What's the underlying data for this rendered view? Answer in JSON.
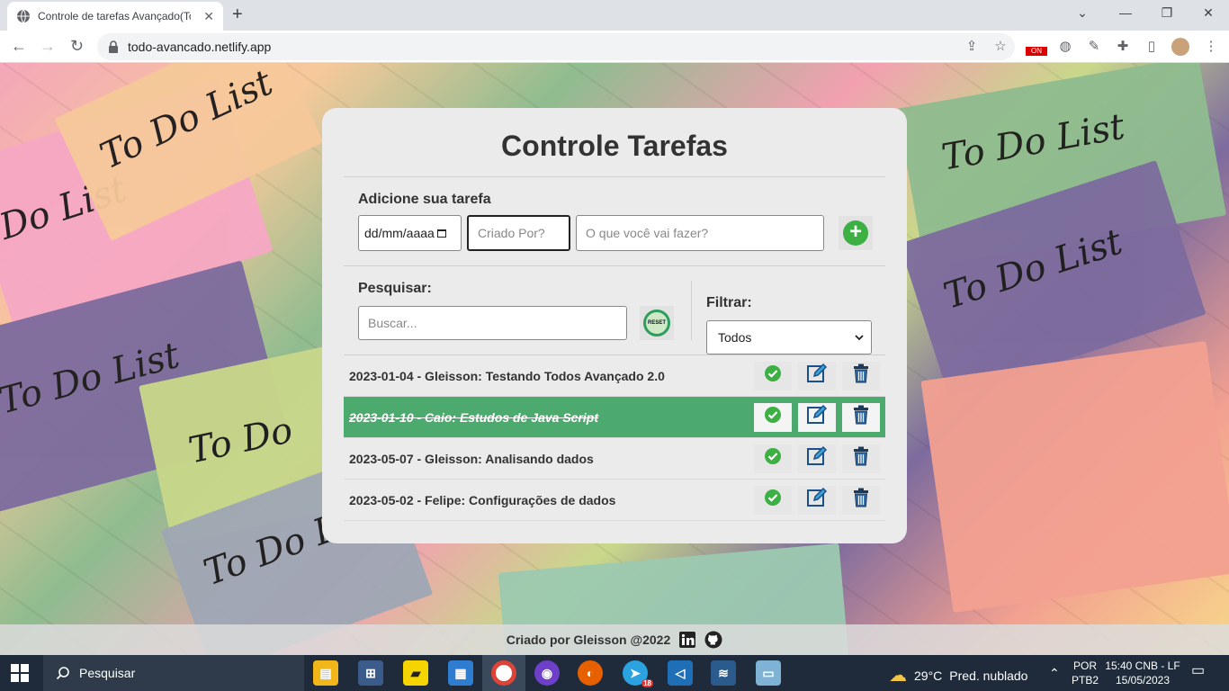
{
  "browser": {
    "tab_title": "Controle de tarefas Avançado(To",
    "url": "todo-avancado.netlify.app",
    "ext_badge": "ON"
  },
  "app": {
    "title": "Controle Tarefas",
    "add_label": "Adicione sua tarefa",
    "date_placeholder": "dd/mm/aaaa",
    "created_by_placeholder": "Criado Por?",
    "what_placeholder": "O que você vai fazer?",
    "search_label": "Pesquisar:",
    "search_placeholder": "Buscar...",
    "reset_label": "RESET",
    "filter_label": "Filtrar:",
    "filter_selected": "Todos"
  },
  "todos": [
    {
      "text": "2023-01-04 - Gleisson: Testando Todos Avançado 2.0",
      "done": false
    },
    {
      "text": "2023-01-10 - Caio: Estudos de Java Script",
      "done": true
    },
    {
      "text": "2023-05-07 - Gleisson: Analisando dados",
      "done": false
    },
    {
      "text": "2023-05-02 - Felipe: Configurações de dados",
      "done": false
    }
  ],
  "footer": {
    "text": "Criado por Gleisson @2022"
  },
  "background_notes": [
    "To Do List",
    "Do List",
    "To Do List",
    "To Do",
    "To Do Li",
    "To Do List",
    "To Do List"
  ],
  "taskbar": {
    "search_text": "Pesquisar",
    "temperature": "29°C",
    "weather": "Pred. nublado",
    "lang_top": "POR",
    "lang_bottom": "PTB2",
    "time": "15:40 CNB - LF",
    "date": "15/05/2023",
    "telegram_badge": "18"
  },
  "colors": {
    "accent_green": "#4caa6e",
    "add_green": "#3cb043",
    "edit_blue": "#1b4f8a"
  }
}
